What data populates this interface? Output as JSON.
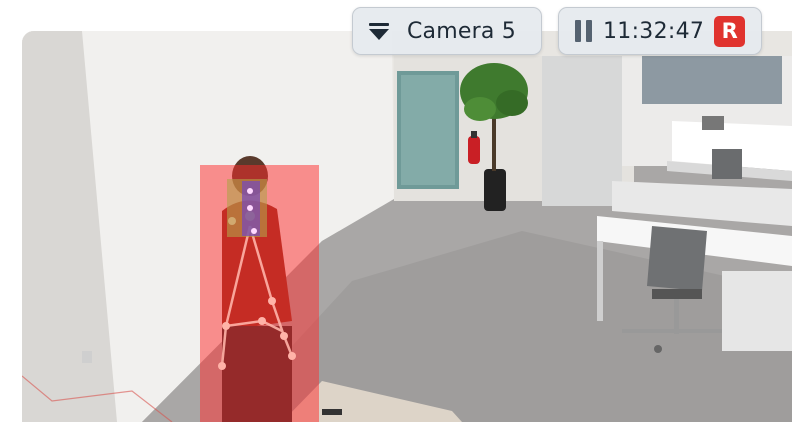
{
  "camera_selector": {
    "label": "Camera 5",
    "icon": "dropdown-menu-icon"
  },
  "playback": {
    "state_icon": "pause-icon",
    "time": "11:32:47",
    "recording_badge": "R",
    "recording_color": "#e0332e"
  },
  "detection": {
    "object": "person",
    "highlight_color": "#ff2a2a"
  }
}
